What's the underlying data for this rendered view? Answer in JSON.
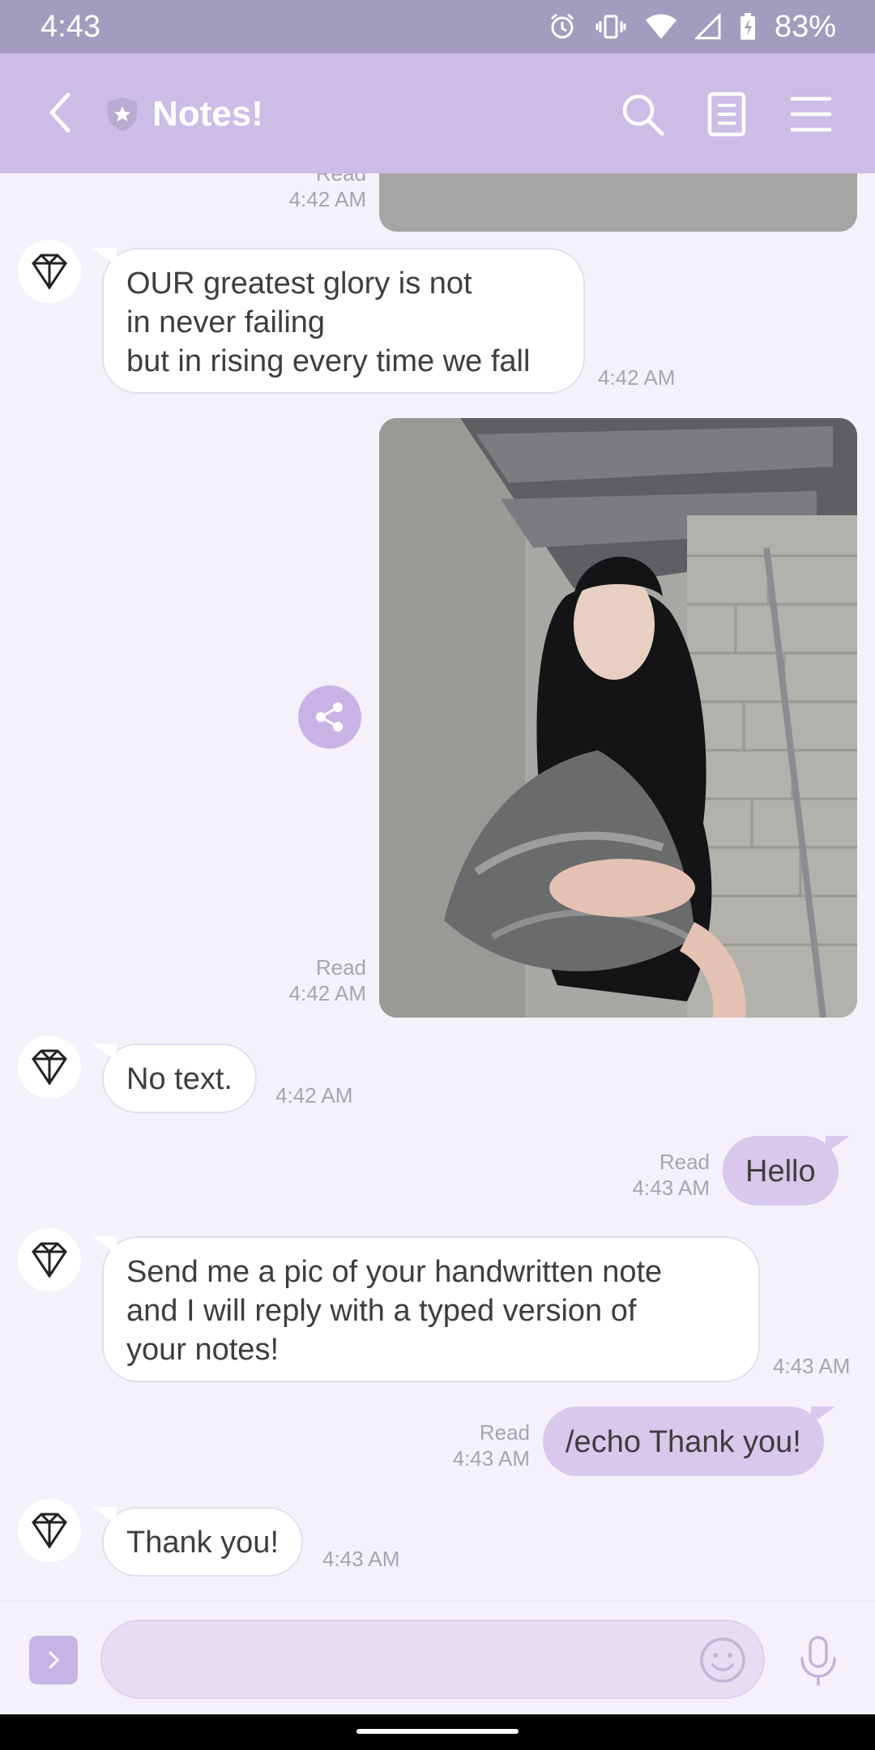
{
  "status_bar": {
    "time": "4:43",
    "battery": "83%"
  },
  "header": {
    "title": "Notes!"
  },
  "messages": {
    "top_meta": {
      "read": "Read",
      "time": "4:42 AM"
    },
    "quote": {
      "lines": [
        "OUR greatest glory is not",
        "in never failing",
        "but in rising every time we fall"
      ],
      "time": "4:42 AM"
    },
    "photo": {
      "read": "Read",
      "time": "4:42 AM"
    },
    "no_text": {
      "text": "No text.",
      "time": "4:42 AM"
    },
    "hello": {
      "read": "Read",
      "time": "4:43 AM",
      "text": "Hello"
    },
    "instructions": {
      "lines": [
        "Send me a pic of your handwritten note",
        "and I will reply with a typed version of",
        "your notes!"
      ],
      "time": "4:43 AM"
    },
    "echo": {
      "read": "Read",
      "time": "4:43 AM",
      "text": "/echo Thank you!"
    },
    "thanks": {
      "text": "Thank you!",
      "time": "4:43 AM"
    }
  },
  "input": {
    "placeholder": "",
    "value": ""
  },
  "icons": {
    "back": "chevron-left-icon",
    "shield": "shield-star-icon",
    "search": "search-icon",
    "notes": "document-icon",
    "menu": "hamburger-menu-icon",
    "share": "share-icon",
    "emoji": "smiley-icon",
    "mic": "microphone-icon",
    "expand": "chevron-right-icon"
  },
  "colors": {
    "header": "#cbbde6",
    "status_bar": "#a49cbf",
    "outgoing_bubble": "#d8c8ec",
    "background": "#f4f1fb"
  }
}
